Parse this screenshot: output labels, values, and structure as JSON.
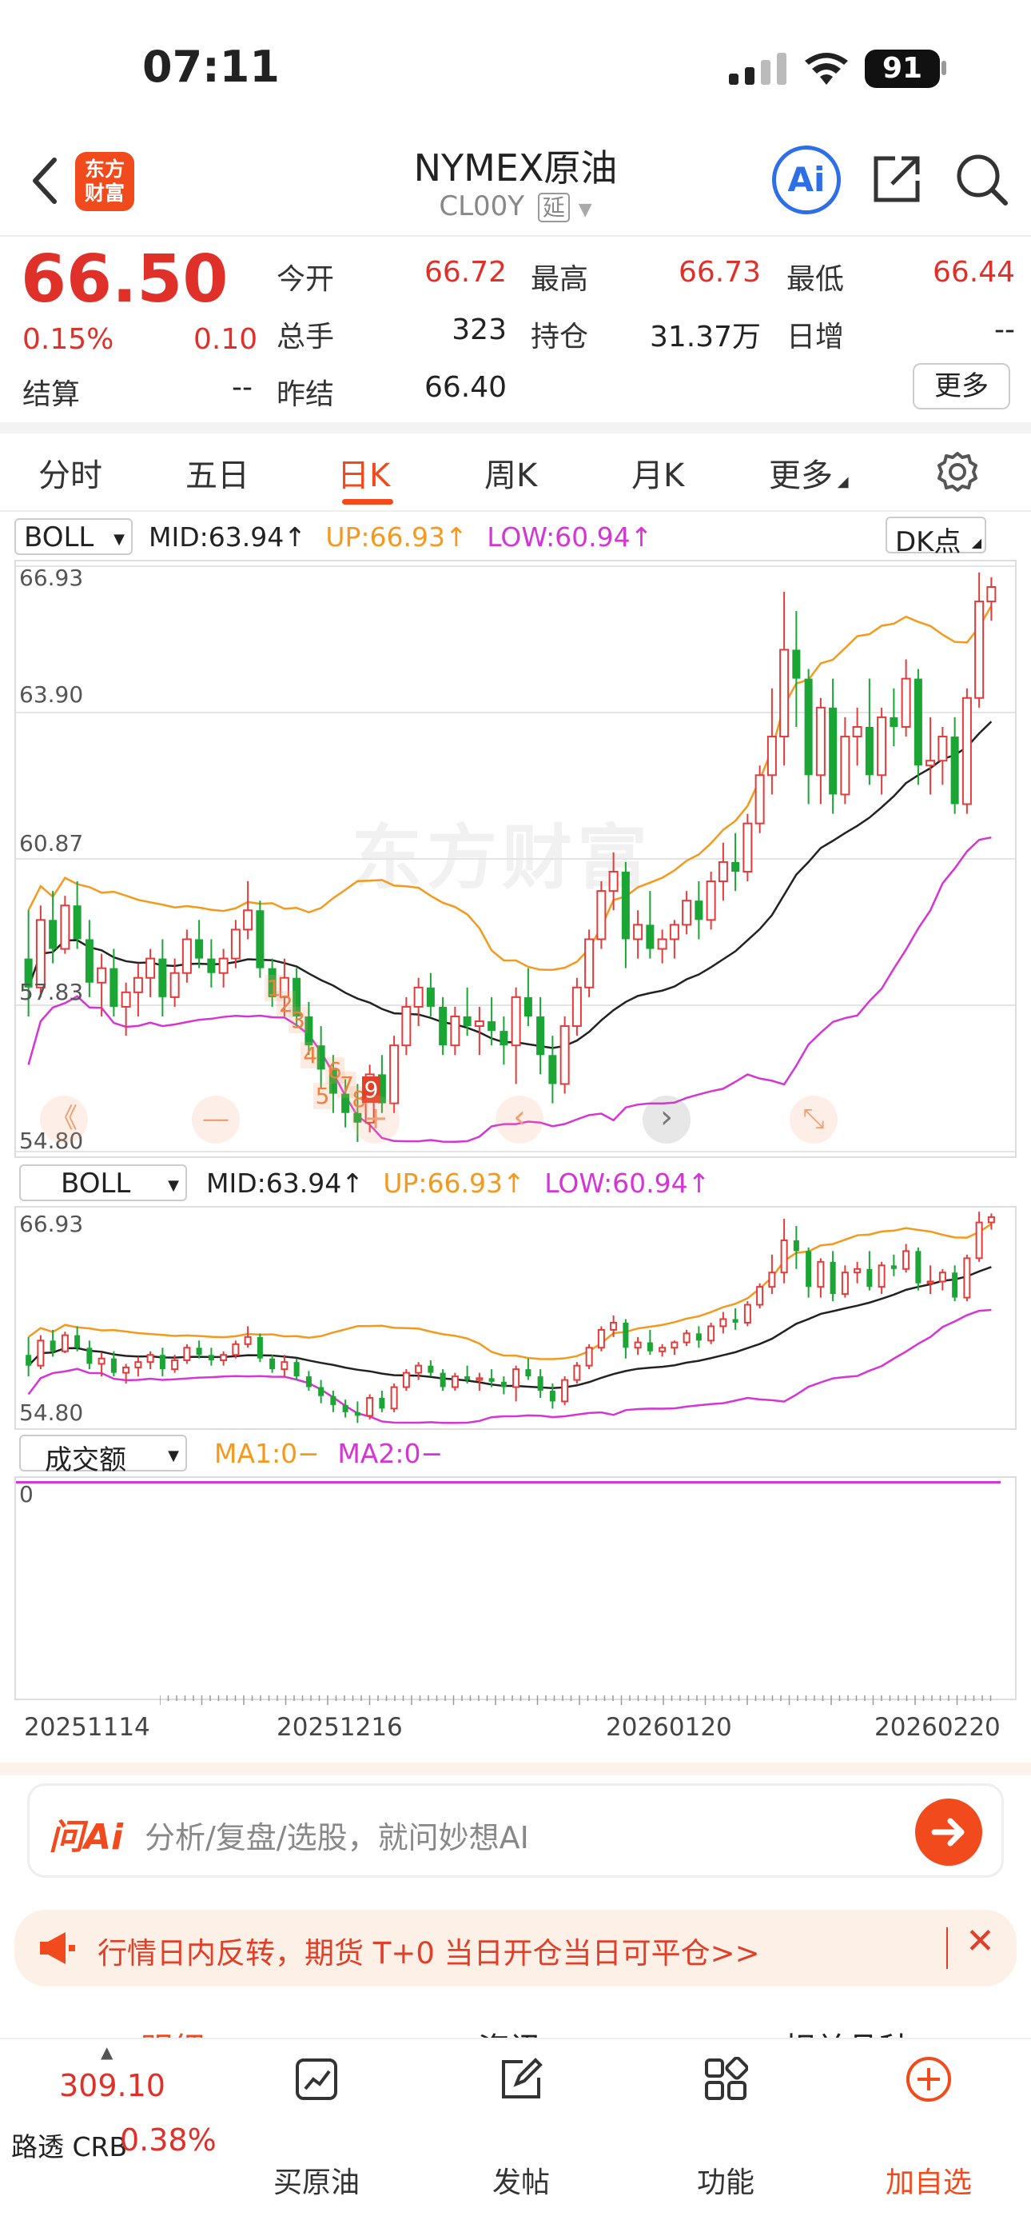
{
  "status_bar": {
    "time": "07:11",
    "battery": "91"
  },
  "header": {
    "title": "NYMEX原油",
    "code": "CL00Y",
    "delay_badge": "延",
    "logo_text": "东方财富",
    "ai_label": "Ai"
  },
  "quote": {
    "price": "66.50",
    "change_pct": "0.15%",
    "change": "0.10",
    "fields": [
      {
        "label": "今开",
        "value": "66.72"
      },
      {
        "label": "最高",
        "value": "66.73"
      },
      {
        "label": "最低",
        "value": "66.44"
      },
      {
        "label": "总手",
        "value": "323"
      },
      {
        "label": "持仓",
        "value": "31.37万"
      },
      {
        "label": "日增",
        "value": "--"
      },
      {
        "label": "结算",
        "value": "--"
      },
      {
        "label": "昨结",
        "value": "66.40"
      }
    ],
    "more_button": "更多"
  },
  "tabs": [
    {
      "label": "分时"
    },
    {
      "label": "五日"
    },
    {
      "label": "日K"
    },
    {
      "label": "周K"
    },
    {
      "label": "月K"
    },
    {
      "label": "更多"
    }
  ],
  "main_chart": {
    "indicator": "BOLL",
    "mid": "MID:63.94",
    "up": "UP:66.93",
    "low": "LOW:60.94",
    "arrow": "↑",
    "dk_button": "DK点",
    "y_labels": [
      "66.93",
      "63.90",
      "60.87",
      "57.83",
      "54.80"
    ],
    "watermark": "东方财富",
    "signal_numbers": [
      "1",
      "2",
      "3",
      "4",
      "5",
      "6",
      "7",
      "8",
      "9"
    ],
    "controls": [
      "《",
      "—",
      "+",
      "‹",
      "›",
      "⤡"
    ]
  },
  "sub_chart": {
    "indicator": "BOLL",
    "mid": "MID:63.94",
    "up": "UP:66.93",
    "low": "LOW:60.94",
    "arrow": "↑",
    "y_labels": [
      "66.93",
      "54.80"
    ]
  },
  "volume_chart": {
    "indicator": "成交额",
    "ma1": "MA1:0−",
    "ma2": "MA2:0−",
    "y_label": "0"
  },
  "dates": [
    "20251114",
    "20251216",
    "20260120",
    "20260220"
  ],
  "ai_bar": {
    "brand": "问Ai",
    "placeholder": "分析/复盘/选股，就问妙想AI"
  },
  "notice": {
    "text": "行情日内反转，期货 T+0 当日开仓当日可平仓>>"
  },
  "partial_tabs": [
    "明细",
    "资讯",
    "相关品种"
  ],
  "bottom_nav": {
    "index_value": "309.10",
    "index_name": "路透 CRB",
    "index_change": "0.38%",
    "items": [
      {
        "label": "买原油"
      },
      {
        "label": "发帖"
      },
      {
        "label": "功能"
      },
      {
        "label": "加自选"
      }
    ]
  },
  "chart_data": {
    "type": "candlestick",
    "ylim": [
      54.8,
      66.93
    ],
    "candles": [
      [
        58.8,
        59.8,
        57.6,
        58.2
      ],
      [
        58.2,
        59.9,
        58,
        59.6
      ],
      [
        59.6,
        60.2,
        58.7,
        59.0
      ],
      [
        59.0,
        60.1,
        58.9,
        59.9
      ],
      [
        59.9,
        60.4,
        59,
        59.2
      ],
      [
        59.2,
        59.6,
        58.0,
        58.3
      ],
      [
        58.3,
        58.9,
        57.6,
        58.6
      ],
      [
        58.6,
        59.0,
        57.6,
        57.8
      ],
      [
        57.8,
        58.3,
        57.2,
        58.1
      ],
      [
        58.1,
        58.7,
        57.6,
        58.4
      ],
      [
        58.4,
        59.0,
        58.0,
        58.8
      ],
      [
        58.8,
        59.2,
        57.6,
        58.0
      ],
      [
        58.0,
        58.8,
        57.8,
        58.5
      ],
      [
        58.5,
        59.4,
        58.3,
        59.2
      ],
      [
        59.2,
        59.6,
        58.6,
        58.8
      ],
      [
        58.8,
        59.2,
        58.2,
        58.5
      ],
      [
        58.5,
        59.0,
        58.2,
        58.8
      ],
      [
        58.8,
        59.6,
        58.6,
        59.4
      ],
      [
        59.4,
        60.4,
        59.2,
        59.8
      ],
      [
        59.8,
        60.0,
        58.4,
        58.6
      ],
      [
        58.6,
        58.8,
        57.8,
        58.0
      ],
      [
        58.0,
        58.8,
        57.6,
        58.4
      ],
      [
        58.4,
        58.6,
        57.4,
        57.6
      ],
      [
        57.6,
        57.9,
        56.8,
        57.0
      ],
      [
        57.0,
        57.4,
        56.1,
        56.5
      ],
      [
        56.5,
        56.8,
        55.6,
        56.0
      ],
      [
        56.0,
        56.3,
        55.3,
        55.6
      ],
      [
        55.6,
        56.2,
        55.0,
        55.4
      ],
      [
        55.4,
        56.6,
        55.2,
        56.4
      ],
      [
        56.4,
        56.8,
        55.6,
        55.8
      ],
      [
        55.8,
        57.2,
        55.6,
        57.0
      ],
      [
        57.0,
        58.0,
        56.8,
        57.8
      ],
      [
        57.8,
        58.4,
        57.4,
        58.2
      ],
      [
        58.2,
        58.5,
        57.6,
        57.8
      ],
      [
        57.8,
        58.0,
        56.8,
        57.0
      ],
      [
        57.0,
        57.8,
        56.8,
        57.6
      ],
      [
        57.6,
        58.2,
        57.2,
        57.4
      ],
      [
        57.4,
        57.8,
        56.8,
        57.5
      ],
      [
        57.5,
        58.0,
        57.0,
        57.3
      ],
      [
        57.3,
        57.6,
        56.6,
        57.0
      ],
      [
        57.0,
        58.2,
        56.2,
        58.0
      ],
      [
        58.0,
        58.6,
        57.4,
        57.6
      ],
      [
        57.6,
        58.0,
        56.4,
        56.8
      ],
      [
        56.8,
        57.2,
        55.8,
        56.2
      ],
      [
        56.2,
        57.6,
        56.0,
        57.4
      ],
      [
        57.4,
        58.4,
        57.2,
        58.2
      ],
      [
        58.2,
        59.4,
        58.0,
        59.2
      ],
      [
        59.2,
        60.4,
        59.0,
        60.2
      ],
      [
        60.2,
        61.0,
        59.8,
        60.6
      ],
      [
        60.6,
        60.8,
        58.6,
        59.2
      ],
      [
        59.2,
        59.8,
        58.8,
        59.5
      ],
      [
        59.5,
        60.2,
        58.8,
        59.0
      ],
      [
        59.0,
        59.4,
        58.7,
        59.2
      ],
      [
        59.2,
        59.6,
        58.8,
        59.5
      ],
      [
        59.5,
        60.2,
        59.3,
        60.0
      ],
      [
        60.0,
        60.4,
        59.2,
        59.6
      ],
      [
        59.6,
        60.6,
        59.4,
        60.4
      ],
      [
        60.4,
        61.2,
        60.0,
        60.8
      ],
      [
        60.8,
        61.4,
        60.2,
        60.6
      ],
      [
        60.6,
        61.8,
        60.4,
        61.6
      ],
      [
        61.6,
        62.8,
        61.4,
        62.6
      ],
      [
        62.6,
        64.4,
        62.2,
        63.4
      ],
      [
        63.4,
        66.4,
        62.8,
        65.2
      ],
      [
        65.2,
        66.0,
        63.6,
        64.6
      ],
      [
        64.6,
        64.8,
        62.0,
        62.6
      ],
      [
        62.6,
        64.2,
        62.0,
        64.0
      ],
      [
        64.0,
        64.6,
        61.8,
        62.2
      ],
      [
        62.2,
        63.8,
        62.0,
        63.4
      ],
      [
        63.4,
        64.0,
        62.8,
        63.6
      ],
      [
        63.6,
        64.6,
        62.4,
        62.6
      ],
      [
        62.6,
        64.0,
        62.2,
        63.8
      ],
      [
        63.8,
        64.4,
        63.2,
        63.6
      ],
      [
        63.6,
        65.0,
        63.4,
        64.6
      ],
      [
        64.6,
        64.8,
        62.4,
        62.8
      ],
      [
        62.8,
        63.8,
        62.2,
        62.9
      ],
      [
        62.9,
        63.6,
        62.4,
        63.4
      ],
      [
        63.4,
        63.8,
        61.8,
        62.0
      ],
      [
        62.0,
        64.4,
        61.8,
        64.2
      ],
      [
        64.2,
        66.8,
        64.0,
        66.2
      ],
      [
        66.2,
        66.7,
        65.8,
        66.5
      ]
    ]
  }
}
